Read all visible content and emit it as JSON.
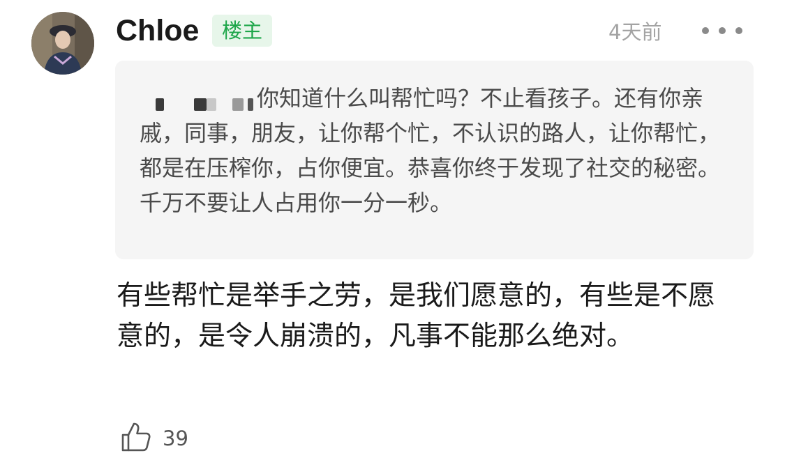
{
  "comment": {
    "username": "Chloe",
    "op_badge": "楼主",
    "timestamp": "4天前",
    "more_icon": "ellipsis-horizontal-icon",
    "avatar_icon": "user-avatar-photo",
    "quote": {
      "redacted_username": true,
      "text": "你知道什么叫帮忙吗？不止看孩子。还有你亲戚，同事，朋友，让你帮个忙，不认识的路人，让你帮忙，都是在压榨你，占你便宜。恭喜你终于发现了社交的秘密。千万不要让人占用你一分一秒。"
    },
    "reply_text": "有些帮忙是举手之劳，是我们愿意的，有些是不愿意的，是令人崩溃的，凡事不能那么绝对。",
    "likes": {
      "icon": "thumbs-up-icon",
      "count": "39"
    }
  },
  "colors": {
    "badge_bg": "#e7f6ea",
    "badge_text": "#1ea64a",
    "quote_bg": "#f5f5f5",
    "muted_text": "#a3a3a3"
  }
}
